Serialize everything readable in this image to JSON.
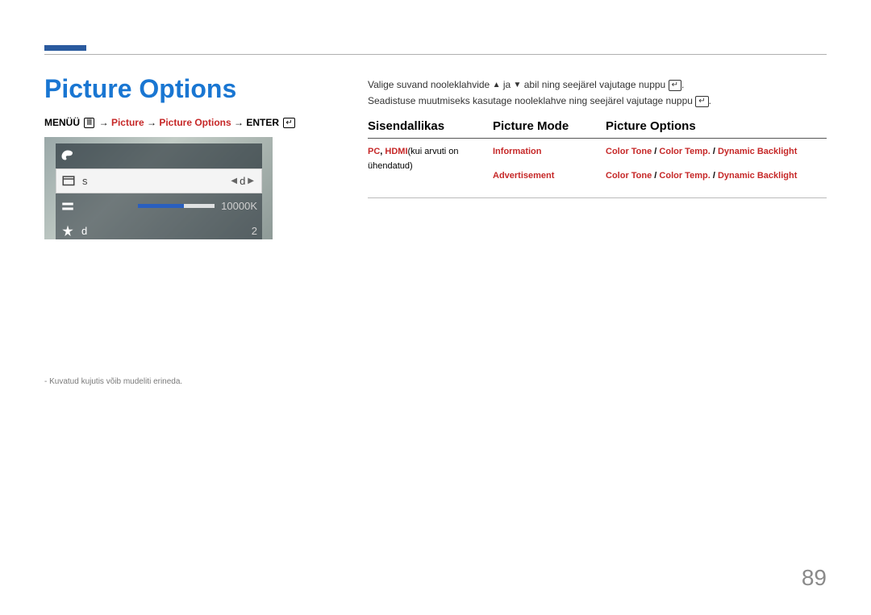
{
  "title": "Picture Options",
  "breadcrumb": {
    "menu": "MENÜÜ",
    "arrow": "→",
    "picture": "Picture",
    "picture_options": "Picture Options",
    "enter": "ENTER"
  },
  "screenshot": {
    "row1_label": "s",
    "row1_value": "d",
    "row2_value": "10000K",
    "row3_label": "d",
    "row3_value": "2"
  },
  "footnote": "Kuvatud kujutis võib mudeliti erineda.",
  "body": {
    "line1a": "Valige suvand nooleklahvide",
    "line1b": "ja",
    "line1c": "abil ning seejärel vajutage nuppu",
    "line2a": "Seadistuse muutmiseks kasutage nooleklahve ning seejärel vajutage nuppu"
  },
  "table": {
    "headers": {
      "c1": "Sisendallikas",
      "c2": "Picture Mode",
      "c3": "Picture Options"
    },
    "row1": {
      "c1a": "PC",
      "c1sep": ", ",
      "c1b": "HDMI",
      "c1c": "(kui arvuti on ühendatud)",
      "c2a": "Information",
      "c2b": "Advertisement",
      "c3a_1": "Color Tone",
      "c3a_2": "Color Temp.",
      "c3a_3": "Dynamic Backlight",
      "c3b_1": "Color Tone",
      "c3b_2": "Color Temp.",
      "c3b_3": "Dynamic Backlight",
      "slash": " / "
    }
  },
  "page_number": "89"
}
